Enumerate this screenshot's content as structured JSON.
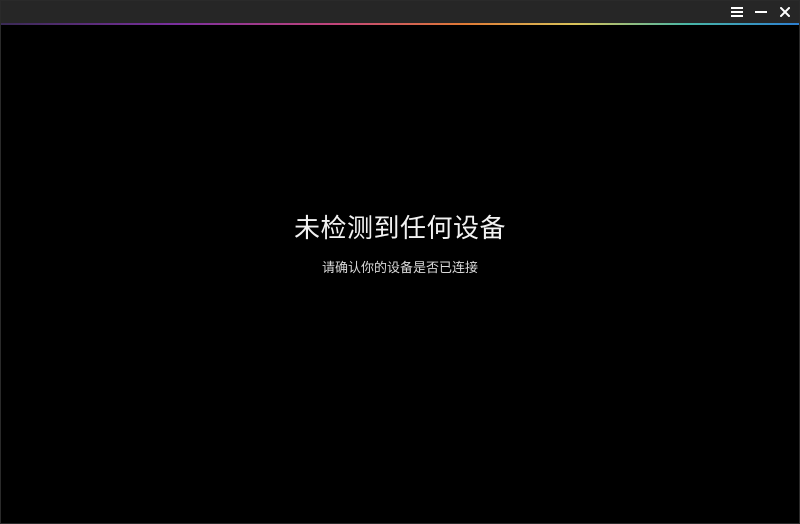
{
  "window": {
    "accent_gradient": [
      "#3a2a55",
      "#7a2f9e",
      "#c2457a",
      "#e07a35",
      "#d9c35a",
      "#49b6a6",
      "#2d7fd1"
    ],
    "background": "#000000",
    "titlebar_background": "#262626"
  },
  "controls": {
    "menu_icon": "menu-icon",
    "minimize_icon": "minimize-icon",
    "close_icon": "close-icon"
  },
  "main": {
    "title": "未检测到任何设备",
    "subtitle": "请确认你的设备是否已连接"
  }
}
